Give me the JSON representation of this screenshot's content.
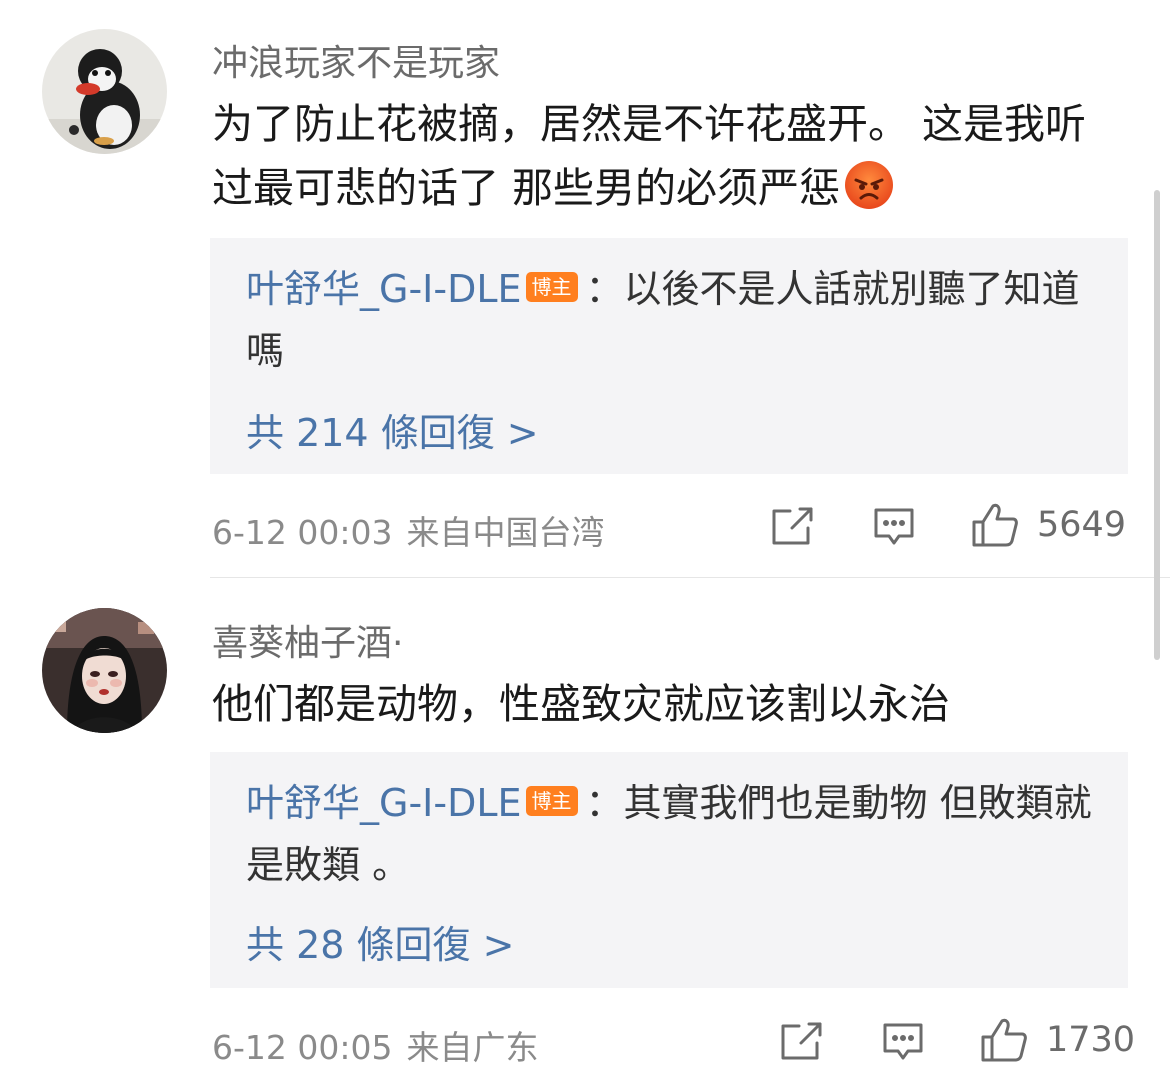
{
  "comments": [
    {
      "username": "冲浪玩家不是玩家",
      "text": "为了防止花被摘，居然是不许花盛开。 这是我听过最可悲的话了  那些男的必须严惩",
      "emoji": "angry-face-emoji",
      "reply": {
        "author": "叶舒华_G-I-DLE",
        "badge": "博主",
        "text": "：以後不是人話就別聽了知道嗎",
        "count_label": "共 214 條回復 >"
      },
      "time": "6-12 00:03",
      "location": "来自中国台湾",
      "likes": "5649"
    },
    {
      "username": "喜葵柚子酒·",
      "text": "他们都是动物，性盛致灾就应该割以永治",
      "reply": {
        "author": "叶舒华_G-I-DLE",
        "badge": "博主",
        "text": "：其實我們也是動物 但敗類就是敗類 。",
        "count_label": "共 28 條回復 >"
      },
      "time": "6-12 00:05",
      "location": "来自广东",
      "likes": "1730"
    }
  ],
  "icons": [
    "share-icon",
    "comment-icon",
    "like-icon"
  ],
  "colors": {
    "link_blue": "#4a74a8",
    "badge_orange": "#ff7f1f",
    "reply_bg": "#f4f4f6",
    "meta_gray": "#8a8a8a"
  }
}
